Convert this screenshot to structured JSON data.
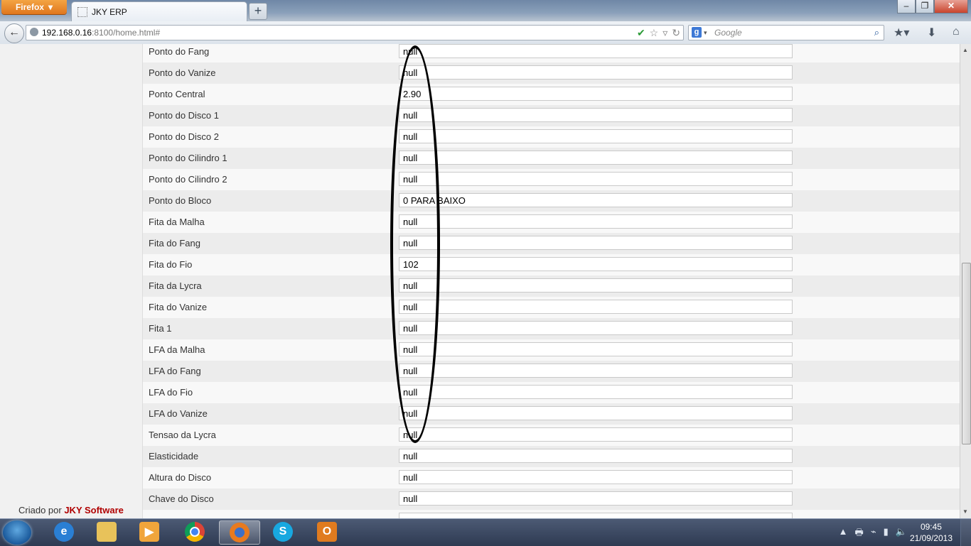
{
  "browser": {
    "menu_button": "Firefox",
    "tab_title": "JKY ERP",
    "new_tab": "+",
    "window_controls": [
      "–",
      "❐",
      "✕"
    ],
    "url_host": "192.168.0.16",
    "url_rest": ":8100/home.html#",
    "search_engine": "g",
    "search_placeholder": "Google"
  },
  "page": {
    "credit_prefix": "Criado por",
    "credit_brand": "JKY Software",
    "brand_color": "#b00000",
    "rows": [
      {
        "label": "Ponto do Fang",
        "value": "null"
      },
      {
        "label": "Ponto do Vanize",
        "value": "null"
      },
      {
        "label": "Ponto Central",
        "value": "2.90"
      },
      {
        "label": "Ponto do Disco 1",
        "value": "null"
      },
      {
        "label": "Ponto do Disco 2",
        "value": "null"
      },
      {
        "label": "Ponto do Cilindro 1",
        "value": "null"
      },
      {
        "label": "Ponto do Cilindro 2",
        "value": "null"
      },
      {
        "label": "Ponto do Bloco",
        "value": "0 PARA BAIXO"
      },
      {
        "label": "Fita da Malha",
        "value": "null"
      },
      {
        "label": "Fita do Fang",
        "value": "null"
      },
      {
        "label": "Fita do Fio",
        "value": "102"
      },
      {
        "label": "Fita da Lycra",
        "value": "null"
      },
      {
        "label": "Fita do Vanize",
        "value": "null"
      },
      {
        "label": "Fita 1",
        "value": "null"
      },
      {
        "label": "LFA da Malha",
        "value": "null"
      },
      {
        "label": "LFA do Fang",
        "value": "null"
      },
      {
        "label": "LFA do Fio",
        "value": "null"
      },
      {
        "label": "LFA do Vanize",
        "value": "null"
      },
      {
        "label": "Tensao da Lycra",
        "value": "null"
      },
      {
        "label": "Elasticidade",
        "value": "null"
      },
      {
        "label": "Altura do Disco",
        "value": "null"
      },
      {
        "label": "Chave do Disco",
        "value": "null"
      },
      {
        "label": "",
        "value": ""
      }
    ]
  },
  "taskbar": {
    "apps": [
      "start-orb",
      "internet-explorer",
      "file-explorer",
      "media-player",
      "chrome",
      "firefox",
      "skype",
      "outlook"
    ],
    "active_app": "firefox",
    "time": "09:45",
    "date": "21/09/2013"
  }
}
